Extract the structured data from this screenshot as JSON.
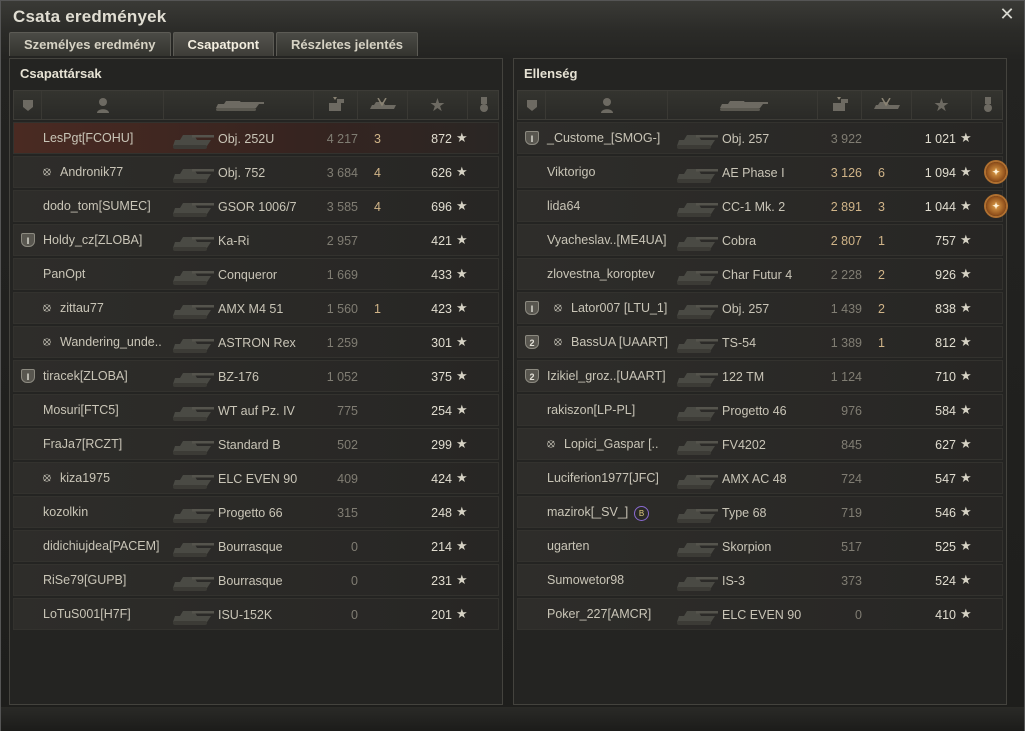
{
  "window": {
    "title": "Csata eredmények",
    "close_icon": "close-icon"
  },
  "tabs": [
    {
      "label": "Személyes eredmény",
      "active": false
    },
    {
      "label": "Csapatpont",
      "active": true
    },
    {
      "label": "Részletes jelentés",
      "active": false
    }
  ],
  "team": {
    "title": "Csapattársak",
    "players": [
      {
        "name": "LesPgt[FCOHU]",
        "tank": "Obj. 252U",
        "damage": "4 217",
        "kills": "3",
        "xp": "872",
        "self": true,
        "platoon": "",
        "xray": false
      },
      {
        "name": "Andronik77",
        "tank": "Obj. 752",
        "damage": "3 684",
        "kills": "4",
        "xp": "626",
        "self": false,
        "platoon": "",
        "xray": true
      },
      {
        "name": "dodo_tom[SUMEC]",
        "tank": "GSOR 1006/7",
        "damage": "3 585",
        "kills": "4",
        "xp": "696",
        "self": false,
        "platoon": "",
        "xray": false
      },
      {
        "name": "Holdy_cz[ZLOBA]",
        "tank": "Ka-Ri",
        "damage": "2 957",
        "kills": "",
        "xp": "421",
        "self": false,
        "platoon": "I",
        "xray": false
      },
      {
        "name": "PanOpt",
        "tank": "Conqueror",
        "damage": "1 669",
        "kills": "",
        "xp": "433",
        "self": false,
        "platoon": "",
        "xray": false
      },
      {
        "name": "zittau77",
        "tank": "AMX M4 51",
        "damage": "1 560",
        "kills": "1",
        "xp": "423",
        "self": false,
        "platoon": "",
        "xray": true
      },
      {
        "name": "Wandering_unde..",
        "tank": "ASTRON Rex",
        "damage": "1 259",
        "kills": "",
        "xp": "301",
        "self": false,
        "platoon": "",
        "xray": true
      },
      {
        "name": "tiracek[ZLOBA]",
        "tank": "BZ-176",
        "damage": "1 052",
        "kills": "",
        "xp": "375",
        "self": false,
        "platoon": "I",
        "xray": false
      },
      {
        "name": "Mosuri[FTC5]",
        "tank": "WT auf Pz. IV",
        "damage": "775",
        "kills": "",
        "xp": "254",
        "self": false,
        "platoon": "",
        "xray": false
      },
      {
        "name": "FraJa7[RCZT]",
        "tank": "Standard B",
        "damage": "502",
        "kills": "",
        "xp": "299",
        "self": false,
        "platoon": "",
        "xray": false
      },
      {
        "name": "kiza1975",
        "tank": "ELC EVEN 90",
        "damage": "409",
        "kills": "",
        "xp": "424",
        "self": false,
        "platoon": "",
        "xray": true
      },
      {
        "name": "kozolkin",
        "tank": "Progetto 66",
        "damage": "315",
        "kills": "",
        "xp": "248",
        "self": false,
        "platoon": "",
        "xray": false
      },
      {
        "name": "didichiujdea[PACEM]",
        "tank": "Bourrasque",
        "damage": "0",
        "kills": "",
        "xp": "214",
        "self": false,
        "platoon": "",
        "xray": false
      },
      {
        "name": "RiSe79[GUPB]",
        "tank": "Bourrasque",
        "damage": "0",
        "kills": "",
        "xp": "231",
        "self": false,
        "platoon": "",
        "xray": false
      },
      {
        "name": "LoTuS001[H7F]",
        "tank": "ISU-152K",
        "damage": "0",
        "kills": "",
        "xp": "201",
        "self": false,
        "platoon": "",
        "xray": false
      }
    ]
  },
  "enemy": {
    "title": "Ellenség",
    "players": [
      {
        "name": "_Custome_[SMOG-]",
        "tank": "Obj. 257",
        "damage": "3 922",
        "kills": "",
        "xp": "1 021",
        "platoon": "I",
        "xray": false,
        "medal": false,
        "hl": false
      },
      {
        "name": "Viktorigo",
        "tank": "AE Phase I",
        "damage": "3 126",
        "kills": "6",
        "xp": "1 094",
        "platoon": "",
        "xray": false,
        "medal": true,
        "hl": true
      },
      {
        "name": "lida64",
        "tank": "CC-1 Mk. 2",
        "damage": "2 891",
        "kills": "3",
        "xp": "1 044",
        "platoon": "",
        "xray": false,
        "medal": true,
        "hl": true
      },
      {
        "name": "Vyacheslav..[ME4UA]",
        "tank": "Cobra",
        "damage": "2 807",
        "kills": "1",
        "xp": "757",
        "platoon": "",
        "xray": false,
        "medal": false,
        "hl": true
      },
      {
        "name": "zlovestna_koroptev",
        "tank": "Char Futur 4",
        "damage": "2 228",
        "kills": "2",
        "xp": "926",
        "platoon": "",
        "xray": false,
        "medal": false,
        "hl": false
      },
      {
        "name": "Lator007 [LTU_1]",
        "tank": "Obj. 257",
        "damage": "1 439",
        "kills": "2",
        "xp": "838",
        "platoon": "I",
        "xray": true,
        "medal": false,
        "hl": false
      },
      {
        "name": "BassUA [UAART]",
        "tank": "TS-54",
        "damage": "1 389",
        "kills": "1",
        "xp": "812",
        "platoon": "2",
        "xray": true,
        "medal": false,
        "hl": false
      },
      {
        "name": "Izikiel_groz..[UAART]",
        "tank": "122 TM",
        "damage": "1 124",
        "kills": "",
        "xp": "710",
        "platoon": "2",
        "xray": false,
        "medal": false,
        "hl": false
      },
      {
        "name": "rakiszon[LP-PL]",
        "tank": "Progetto 46",
        "damage": "976",
        "kills": "",
        "xp": "584",
        "platoon": "",
        "xray": false,
        "medal": false,
        "hl": false
      },
      {
        "name": "Lopici_Gaspar [..",
        "tank": "FV4202",
        "damage": "845",
        "kills": "",
        "xp": "627",
        "platoon": "",
        "xray": true,
        "medal": false,
        "hl": false
      },
      {
        "name": "Luciferion1977[JFC]",
        "tank": "AMX AC 48",
        "damage": "724",
        "kills": "",
        "xp": "547",
        "platoon": "",
        "xray": false,
        "medal": false,
        "hl": false
      },
      {
        "name": "mazirok[_SV_]",
        "tank": "Type 68",
        "damage": "719",
        "kills": "",
        "xp": "546",
        "platoon": "",
        "xray": false,
        "medal": false,
        "hl": false,
        "bon": "B"
      },
      {
        "name": "ugarten",
        "tank": "Skorpion",
        "damage": "517",
        "kills": "",
        "xp": "525",
        "platoon": "",
        "xray": false,
        "medal": false,
        "hl": false
      },
      {
        "name": "Sumowetor98",
        "tank": "IS-3",
        "damage": "373",
        "kills": "",
        "xp": "524",
        "platoon": "",
        "xray": false,
        "medal": false,
        "hl": false
      },
      {
        "name": "Poker_227[AMCR]",
        "tank": "ELC EVEN 90",
        "damage": "0",
        "kills": "",
        "xp": "410",
        "platoon": "",
        "xray": false,
        "medal": false,
        "hl": false
      }
    ]
  },
  "icons": {
    "xray": "eye-slash-icon",
    "star": "★",
    "medal": "✦"
  }
}
